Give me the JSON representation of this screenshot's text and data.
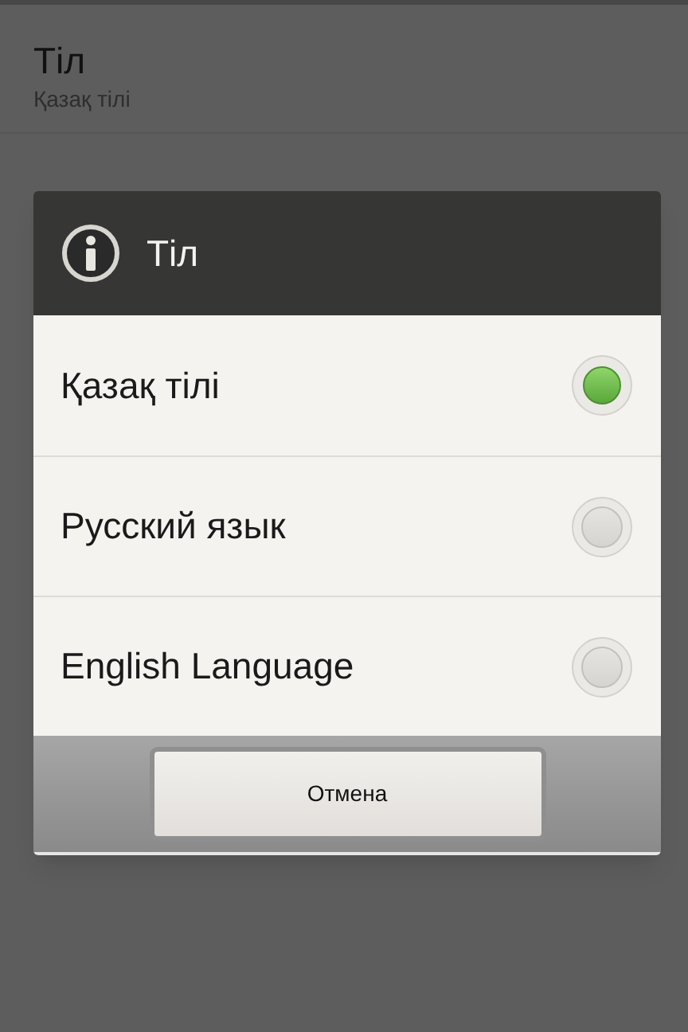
{
  "setting": {
    "title": "Тіл",
    "value": "Қазақ тілі"
  },
  "dialog": {
    "title": "Тіл",
    "options": [
      {
        "label": "Қазақ тілі",
        "selected": true
      },
      {
        "label": "Русский язык",
        "selected": false
      },
      {
        "label": "English Language",
        "selected": false
      }
    ],
    "cancel_button": "Отмена"
  }
}
